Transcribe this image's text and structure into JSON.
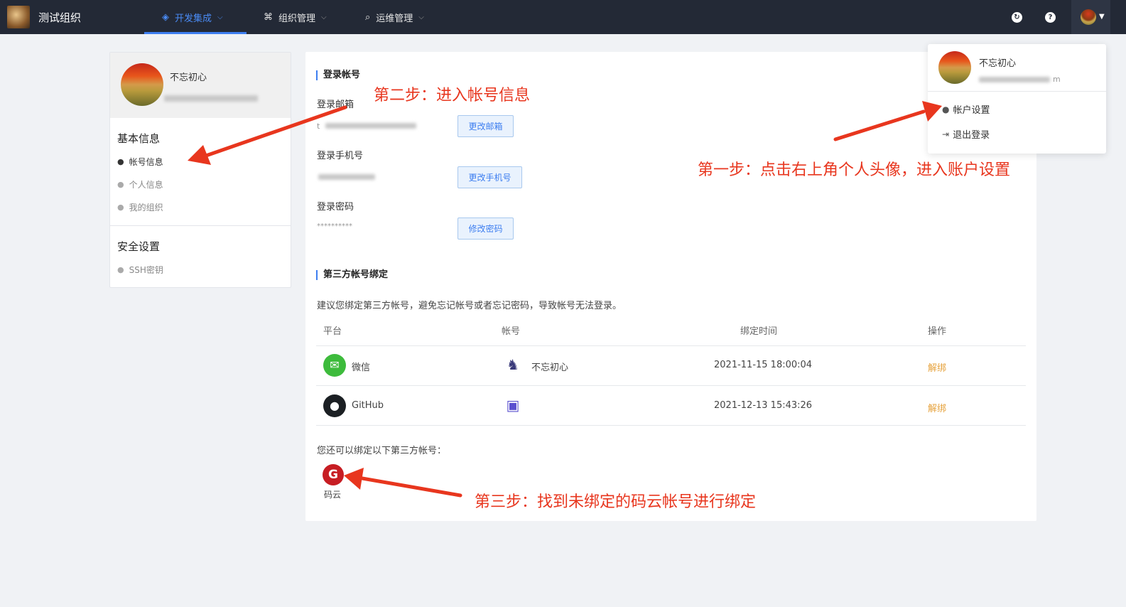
{
  "header": {
    "org_name": "测试组织",
    "nav": [
      {
        "label": "开发集成",
        "icon": "layers-icon",
        "active": true
      },
      {
        "label": "组织管理",
        "icon": "org-tree-icon",
        "active": false
      },
      {
        "label": "运维管理",
        "icon": "ops-search-icon",
        "active": false
      }
    ],
    "sync_icon": "sync-icon",
    "help_icon_glyph": "?"
  },
  "sidebar": {
    "user_name": "不忘初心",
    "basic_title": "基本信息",
    "basic_items": [
      "帐号信息",
      "个人信息",
      "我的组织"
    ],
    "security_title": "安全设置",
    "security_items": [
      "SSH密钥"
    ]
  },
  "account": {
    "section_title": "登录帐号",
    "email_label": "登录邮箱",
    "email_value": "t",
    "email_button": "更改邮箱",
    "phone_label": "登录手机号",
    "phone_button": "更改手机号",
    "password_label": "登录密码",
    "password_value": "**********",
    "password_button": "修改密码"
  },
  "third_party": {
    "section_title": "第三方帐号绑定",
    "hint": "建议您绑定第三方帐号，避免忘记帐号或者忘记密码，导致帐号无法登录。",
    "columns": [
      "平台",
      "帐号",
      "绑定时间",
      "操作"
    ],
    "rows": [
      {
        "platform": "微信",
        "account": "不忘初心",
        "time": "2021-11-15 18:00:04",
        "action": "解绑"
      },
      {
        "platform": "GitHub",
        "account": "",
        "time": "2021-12-13 15:43:26",
        "action": "解绑"
      }
    ],
    "more_hint": "您还可以绑定以下第三方帐号：",
    "available": [
      {
        "name": "码云",
        "glyph": "G"
      }
    ]
  },
  "dropdown": {
    "user_name": "不忘初心",
    "email_tail": "m",
    "items": [
      "帐户设置",
      "退出登录"
    ]
  },
  "annotations": {
    "step1": "第一步：点击右上角个人头像，进入账户设置",
    "step2": "第二步：进入帐号信息",
    "step3": "第三步：找到未绑定的码云帐号进行绑定",
    "color": "#e8361e"
  }
}
